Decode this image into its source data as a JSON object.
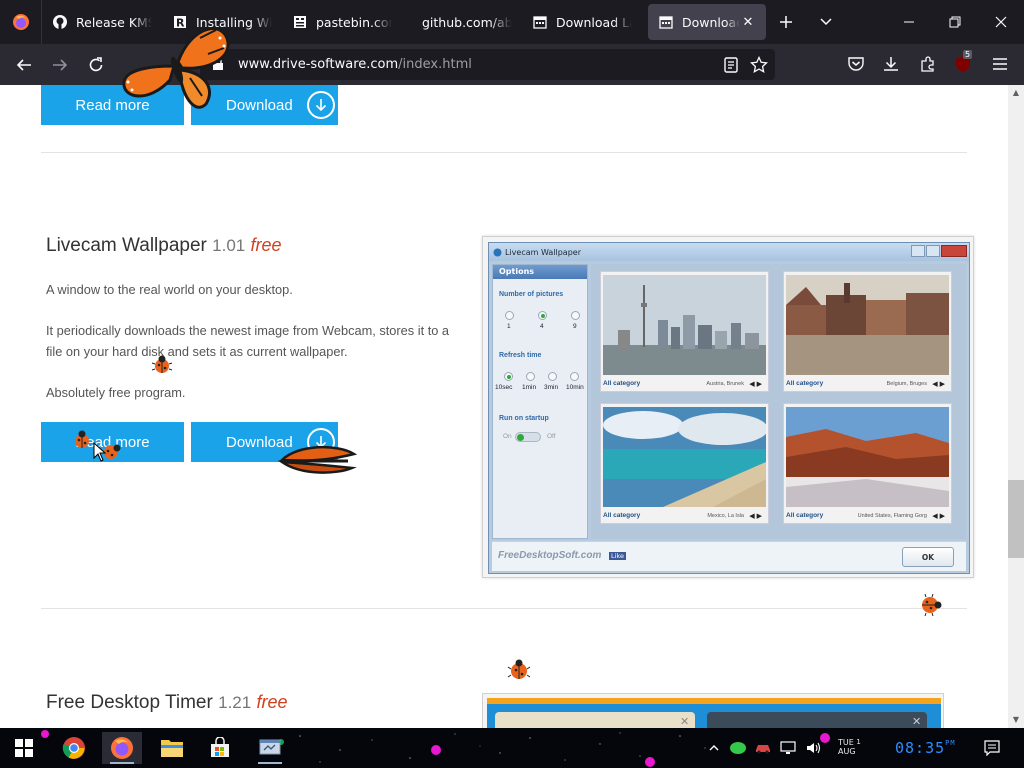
{
  "browser": {
    "tabs": [
      {
        "title": "Release KMSpi",
        "icon": "github-icon"
      },
      {
        "title": "Installing Wine",
        "icon": "r-site-icon"
      },
      {
        "title": "pastebin.com/",
        "icon": "pastebin-icon"
      },
      {
        "title": "github.com/abbo",
        "icon": "none"
      },
      {
        "title": "Download Lad",
        "icon": "calendar-icon"
      },
      {
        "title": "Download A",
        "icon": "calendar-icon",
        "active": true
      }
    ],
    "url_domain": "www.drive-software.com",
    "url_path": "/index.html",
    "extension_badge": "5"
  },
  "page": {
    "top_buttons": {
      "read_more": "Read more",
      "download": "Download"
    },
    "product1": {
      "name": "Livecam Wallpaper",
      "version": "1.01",
      "free_label": "free",
      "desc1": "A window to the real world on your desktop.",
      "desc2": "It periodically downloads the newest image from Webcam, stores it to a file on your hard disk and sets it as current wallpaper.",
      "desc3": "Absolutely free program.",
      "read_more": "Read more",
      "download": "Download"
    },
    "screenshot": {
      "window_title": "Livecam Wallpaper",
      "options_title": "Options",
      "num_pictures_label": "Number of pictures",
      "num_options": [
        "1",
        "4",
        "9"
      ],
      "refresh_label": "Refresh time",
      "refresh_options": [
        "10sec",
        "1min",
        "3min",
        "10min"
      ],
      "startup_label": "Run on startup",
      "toggle_on": "On",
      "toggle_off": "Off",
      "thumbs": [
        {
          "category": "All category",
          "location": "Austria, Brunek"
        },
        {
          "category": "All category",
          "location": "Belgium, Bruges"
        },
        {
          "category": "All category",
          "location": "Mexico, La Isla"
        },
        {
          "category": "All category",
          "location": "United States, Flaming Gorg"
        }
      ],
      "brand": "FreeDesktopSoft.com",
      "like": "Like",
      "ok": "OK"
    },
    "product2": {
      "name": "Free Desktop Timer",
      "version": "1.21",
      "free_label": "free"
    }
  },
  "taskbar": {
    "clock_day": "TUE",
    "clock_month": "AUG",
    "clock_date": "1",
    "clock_time": "08:35",
    "clock_ampm": "PM"
  }
}
